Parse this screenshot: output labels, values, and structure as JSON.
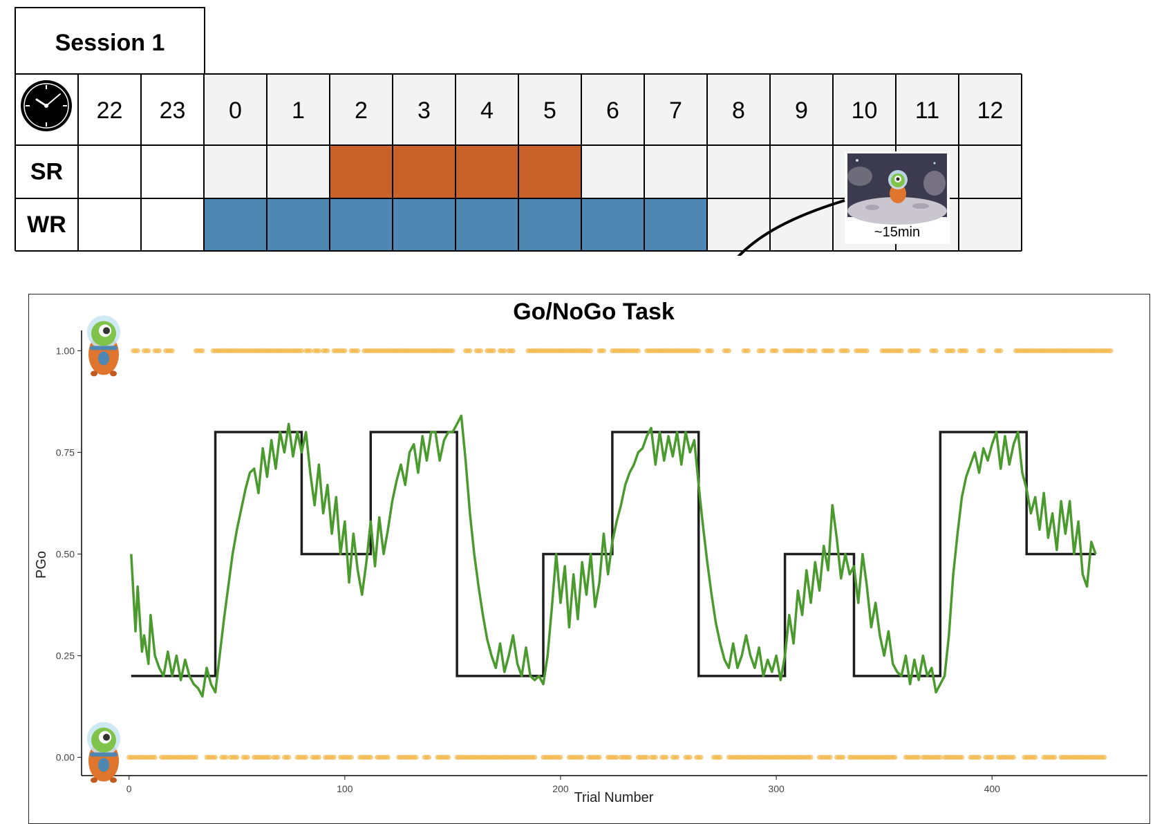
{
  "schedule": {
    "title": "Session 1",
    "hours": [
      "22",
      "23",
      "0",
      "1",
      "2",
      "3",
      "4",
      "5",
      "6",
      "7",
      "8",
      "9",
      "10",
      "11",
      "12"
    ],
    "shaded_hours": [
      "0",
      "1",
      "2",
      "3",
      "4",
      "5",
      "6",
      "7",
      "8",
      "9",
      "10",
      "11",
      "12"
    ],
    "rows": [
      {
        "label": "SR",
        "color": "#c9622a",
        "active_hours": [
          "2",
          "3",
          "4",
          "5"
        ]
      },
      {
        "label": "WR",
        "color": "#4f87b3",
        "active_hours": [
          "0",
          "1",
          "2",
          "3",
          "4",
          "5",
          "6",
          "7"
        ]
      }
    ],
    "clock_icon": "clock-icon",
    "task_thumbnail_icon": "alien-space-scene-icon",
    "task_duration": "~15min"
  },
  "chart_data": {
    "type": "line",
    "title": "Go/NoGo Task",
    "xlabel": "Trial Number",
    "ylabel": "PGo",
    "xlim": [
      -22,
      472
    ],
    "ylim": [
      -0.045,
      1.05
    ],
    "xticks": [
      0,
      100,
      200,
      300,
      400
    ],
    "xtick_labels": [
      "0",
      "100",
      "200",
      "300",
      "400"
    ],
    "yticks": [
      0,
      0.25,
      0.5,
      0.75,
      1.0
    ],
    "ytick_labels": [
      "0.00",
      "0.25",
      "0.50",
      "0.75",
      "1.00"
    ],
    "grid": false,
    "colors": {
      "true_prob": "#1e1e1e",
      "model": "#4a9a2e",
      "responses": "#f2b84b"
    },
    "series": [
      {
        "key": "true_prob",
        "style": "step",
        "segments": [
          {
            "from": 1,
            "to": 40,
            "value": 0.2
          },
          {
            "from": 40,
            "to": 80,
            "value": 0.8
          },
          {
            "from": 80,
            "to": 112,
            "value": 0.5
          },
          {
            "from": 112,
            "to": 152,
            "value": 0.8
          },
          {
            "from": 152,
            "to": 192,
            "value": 0.2
          },
          {
            "from": 192,
            "to": 224,
            "value": 0.5
          },
          {
            "from": 224,
            "to": 264,
            "value": 0.8
          },
          {
            "from": 264,
            "to": 304,
            "value": 0.2
          },
          {
            "from": 304,
            "to": 336,
            "value": 0.5
          },
          {
            "from": 336,
            "to": 376,
            "value": 0.2
          },
          {
            "from": 376,
            "to": 416,
            "value": 0.8
          },
          {
            "from": 416,
            "to": 448,
            "value": 0.5
          }
        ]
      },
      {
        "key": "model",
        "style": "line",
        "x": [
          1,
          3,
          4,
          6,
          7,
          9,
          10,
          12,
          14,
          16,
          18,
          20,
          22,
          24,
          26,
          28,
          30,
          32,
          34,
          36,
          38,
          40,
          42,
          44,
          46,
          48,
          50,
          52,
          54,
          56,
          58,
          60,
          62,
          64,
          66,
          68,
          70,
          72,
          74,
          76,
          78,
          80,
          82,
          84,
          86,
          88,
          90,
          92,
          94,
          96,
          98,
          100,
          102,
          104,
          106,
          108,
          110,
          112,
          114,
          116,
          118,
          120,
          122,
          124,
          126,
          128,
          130,
          132,
          134,
          136,
          138,
          140,
          142,
          144,
          146,
          148,
          150,
          152,
          154,
          156,
          158,
          160,
          162,
          164,
          166,
          168,
          170,
          172,
          174,
          176,
          178,
          180,
          182,
          184,
          186,
          188,
          190,
          192,
          194,
          196,
          198,
          200,
          202,
          204,
          206,
          208,
          210,
          212,
          214,
          216,
          218,
          220,
          222,
          224,
          226,
          228,
          230,
          232,
          234,
          236,
          238,
          240,
          242,
          244,
          246,
          248,
          250,
          252,
          254,
          256,
          258,
          260,
          262,
          264,
          266,
          268,
          270,
          272,
          274,
          276,
          278,
          280,
          282,
          284,
          286,
          288,
          290,
          292,
          294,
          296,
          298,
          300,
          302,
          304,
          306,
          308,
          310,
          312,
          314,
          316,
          318,
          320,
          322,
          324,
          326,
          328,
          330,
          332,
          334,
          336,
          338,
          340,
          342,
          344,
          346,
          348,
          350,
          352,
          354,
          356,
          358,
          360,
          362,
          364,
          366,
          368,
          370,
          372,
          374,
          376,
          378,
          380,
          382,
          384,
          386,
          388,
          390,
          392,
          394,
          396,
          398,
          400,
          402,
          404,
          406,
          408,
          410,
          412,
          414,
          416,
          418,
          420,
          422,
          424,
          426,
          428,
          430,
          432,
          434,
          436,
          438,
          440,
          442,
          444,
          446,
          448
        ],
        "y": [
          0.5,
          0.31,
          0.42,
          0.26,
          0.3,
          0.23,
          0.35,
          0.25,
          0.22,
          0.2,
          0.26,
          0.2,
          0.25,
          0.19,
          0.24,
          0.2,
          0.18,
          0.17,
          0.15,
          0.22,
          0.18,
          0.16,
          0.25,
          0.34,
          0.42,
          0.5,
          0.56,
          0.61,
          0.66,
          0.7,
          0.71,
          0.65,
          0.76,
          0.69,
          0.78,
          0.71,
          0.8,
          0.75,
          0.82,
          0.74,
          0.8,
          0.75,
          0.8,
          0.7,
          0.62,
          0.72,
          0.6,
          0.67,
          0.55,
          0.64,
          0.5,
          0.58,
          0.43,
          0.55,
          0.46,
          0.4,
          0.48,
          0.58,
          0.47,
          0.59,
          0.5,
          0.56,
          0.63,
          0.68,
          0.72,
          0.67,
          0.75,
          0.77,
          0.7,
          0.79,
          0.73,
          0.8,
          0.8,
          0.73,
          0.78,
          0.8,
          0.8,
          0.82,
          0.84,
          0.73,
          0.6,
          0.5,
          0.42,
          0.35,
          0.29,
          0.25,
          0.22,
          0.28,
          0.21,
          0.25,
          0.3,
          0.23,
          0.2,
          0.27,
          0.2,
          0.19,
          0.2,
          0.18,
          0.25,
          0.37,
          0.5,
          0.38,
          0.47,
          0.32,
          0.45,
          0.34,
          0.48,
          0.4,
          0.5,
          0.37,
          0.43,
          0.55,
          0.45,
          0.53,
          0.58,
          0.62,
          0.67,
          0.7,
          0.72,
          0.75,
          0.76,
          0.79,
          0.81,
          0.72,
          0.8,
          0.73,
          0.79,
          0.74,
          0.8,
          0.72,
          0.8,
          0.75,
          0.78,
          0.67,
          0.57,
          0.48,
          0.4,
          0.33,
          0.28,
          0.24,
          0.22,
          0.28,
          0.22,
          0.25,
          0.3,
          0.25,
          0.22,
          0.27,
          0.2,
          0.24,
          0.21,
          0.25,
          0.19,
          0.25,
          0.35,
          0.28,
          0.41,
          0.35,
          0.46,
          0.38,
          0.48,
          0.41,
          0.52,
          0.46,
          0.62,
          0.54,
          0.44,
          0.5,
          0.45,
          0.47,
          0.38,
          0.5,
          0.42,
          0.32,
          0.38,
          0.3,
          0.25,
          0.31,
          0.23,
          0.21,
          0.2,
          0.25,
          0.18,
          0.24,
          0.19,
          0.25,
          0.2,
          0.22,
          0.16,
          0.18,
          0.2,
          0.3,
          0.45,
          0.55,
          0.64,
          0.69,
          0.72,
          0.75,
          0.7,
          0.76,
          0.73,
          0.77,
          0.8,
          0.71,
          0.79,
          0.72,
          0.77,
          0.8,
          0.7,
          0.66,
          0.6,
          0.64,
          0.56,
          0.65,
          0.54,
          0.6,
          0.51,
          0.63,
          0.55,
          0.63,
          0.5,
          0.58,
          0.45,
          0.42,
          0.53,
          0.5
        ]
      },
      {
        "key": "go_responses",
        "style": "points",
        "y_value": 1.0,
        "x_ranges": [
          [
            2,
            4
          ],
          [
            7,
            9
          ],
          [
            12,
            14
          ],
          [
            17,
            20
          ],
          [
            31,
            34
          ],
          [
            39,
            80
          ],
          [
            82,
            84
          ],
          [
            86,
            88
          ],
          [
            90,
            92
          ],
          [
            95,
            100
          ],
          [
            103,
            106
          ],
          [
            109,
            150
          ],
          [
            156,
            158
          ],
          [
            161,
            163
          ],
          [
            166,
            169
          ],
          [
            172,
            174
          ],
          [
            176,
            178
          ],
          [
            185,
            214
          ],
          [
            218,
            220
          ],
          [
            224,
            236
          ],
          [
            240,
            264
          ],
          [
            268,
            270
          ],
          [
            276,
            278
          ],
          [
            285,
            287
          ],
          [
            292,
            294
          ],
          [
            298,
            300
          ],
          [
            304,
            312
          ],
          [
            315,
            318
          ],
          [
            322,
            326
          ],
          [
            330,
            333
          ],
          [
            337,
            342
          ],
          [
            349,
            358
          ],
          [
            362,
            366
          ],
          [
            372,
            374
          ],
          [
            379,
            382
          ],
          [
            385,
            388
          ],
          [
            394,
            396
          ],
          [
            402,
            404
          ],
          [
            411,
            455
          ]
        ]
      },
      {
        "key": "nogo_responses",
        "style": "points",
        "y_value": 0.0,
        "x_ranges": [
          [
            0,
            12
          ],
          [
            15,
            31
          ],
          [
            36,
            40
          ],
          [
            43,
            45
          ],
          [
            47,
            50
          ],
          [
            53,
            55
          ],
          [
            58,
            62
          ],
          [
            63,
            65
          ],
          [
            67,
            69
          ],
          [
            72,
            74
          ],
          [
            78,
            82
          ],
          [
            85,
            88
          ],
          [
            91,
            95
          ],
          [
            98,
            103
          ],
          [
            107,
            112
          ],
          [
            115,
            120
          ],
          [
            125,
            133
          ],
          [
            137,
            139
          ],
          [
            143,
            145
          ],
          [
            146,
            148
          ],
          [
            152,
            188
          ],
          [
            192,
            200
          ],
          [
            204,
            210
          ],
          [
            213,
            218
          ],
          [
            222,
            226
          ],
          [
            228,
            232
          ],
          [
            236,
            240
          ],
          [
            242,
            244
          ],
          [
            247,
            249
          ],
          [
            252,
            254
          ],
          [
            258,
            260
          ],
          [
            263,
            265
          ],
          [
            271,
            274
          ],
          [
            278,
            316
          ],
          [
            320,
            325
          ],
          [
            328,
            331
          ],
          [
            334,
            355
          ],
          [
            360,
            366
          ],
          [
            368,
            376
          ],
          [
            378,
            386
          ],
          [
            390,
            394
          ],
          [
            397,
            400
          ],
          [
            403,
            410
          ],
          [
            415,
            420
          ],
          [
            424,
            429
          ],
          [
            432,
            452
          ]
        ]
      }
    ],
    "marker_icons": [
      {
        "y_value": 1.0,
        "icon": "alien-go-icon"
      },
      {
        "y_value": 0.0,
        "icon": "alien-nogo-icon"
      }
    ]
  }
}
